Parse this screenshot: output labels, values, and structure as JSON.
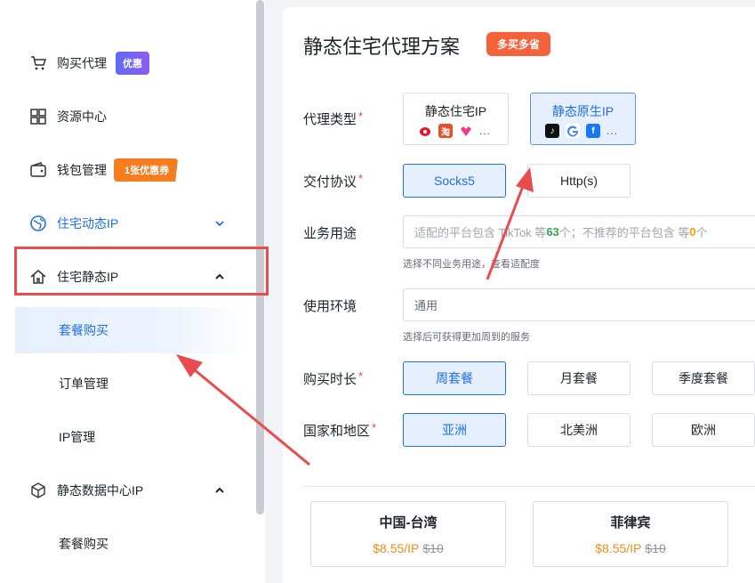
{
  "sidebar": {
    "items": [
      {
        "label": "购买代理",
        "icon": "cart-icon",
        "badge": "优惠"
      },
      {
        "label": "资源中心",
        "icon": "grid-icon"
      },
      {
        "label": "钱包管理",
        "icon": "wallet-icon",
        "badge": "1张优惠券"
      },
      {
        "label": "住宅动态IP",
        "icon": "globe-icon",
        "chevron": "down"
      },
      {
        "label": "住宅静态IP",
        "icon": "home-icon",
        "chevron": "up"
      },
      {
        "label": "套餐购买",
        "active": true
      },
      {
        "label": "订单管理"
      },
      {
        "label": "IP管理"
      },
      {
        "label": "静态数据中心IP",
        "icon": "cube-icon",
        "chevron": "up"
      },
      {
        "label": "套餐购买"
      }
    ]
  },
  "main": {
    "title": "静态住宅代理方案",
    "title_tag": "多买多省",
    "proxy_type": {
      "label": "代理类型",
      "options": [
        {
          "label": "静态住宅IP",
          "selected": false
        },
        {
          "label": "静态原生IP",
          "selected": true
        }
      ],
      "more": "..."
    },
    "protocol": {
      "label": "交付协议",
      "options": [
        {
          "label": "Socks5",
          "selected": true
        },
        {
          "label": "Http(s)",
          "selected": false
        }
      ]
    },
    "usage": {
      "label": "业务用途",
      "placeholder_pre": "适配的平台包含 TikTok 等 ",
      "count_ok": "63",
      "placeholder_mid": "个；不推荐的平台包含 等 ",
      "count_bad": "0",
      "placeholder_post": "个",
      "hint": "选择不同业务用途，查看适配度"
    },
    "environment": {
      "label": "使用环境",
      "value": "通用",
      "hint": "选择后可获得更加周到的服务"
    },
    "duration": {
      "label": "购买时长",
      "options": [
        {
          "label": "周套餐",
          "selected": true
        },
        {
          "label": "月套餐",
          "selected": false
        },
        {
          "label": "季度套餐",
          "selected": false
        }
      ]
    },
    "region": {
      "label": "国家和地区",
      "options": [
        {
          "label": "亚洲",
          "selected": true
        },
        {
          "label": "北美洲",
          "selected": false
        },
        {
          "label": "欧洲",
          "selected": false
        }
      ]
    },
    "region_cards": [
      {
        "name": "中国-台湾",
        "price": "$8.55/IP",
        "old_price": "$10"
      },
      {
        "name": "菲律宾",
        "price": "$8.55/IP",
        "old_price": "$10"
      }
    ]
  },
  "colors": {
    "accent": "#1f6fe5",
    "annotation": "#e94c4f",
    "price": "#f08c1a",
    "tag": "#f4623a"
  }
}
